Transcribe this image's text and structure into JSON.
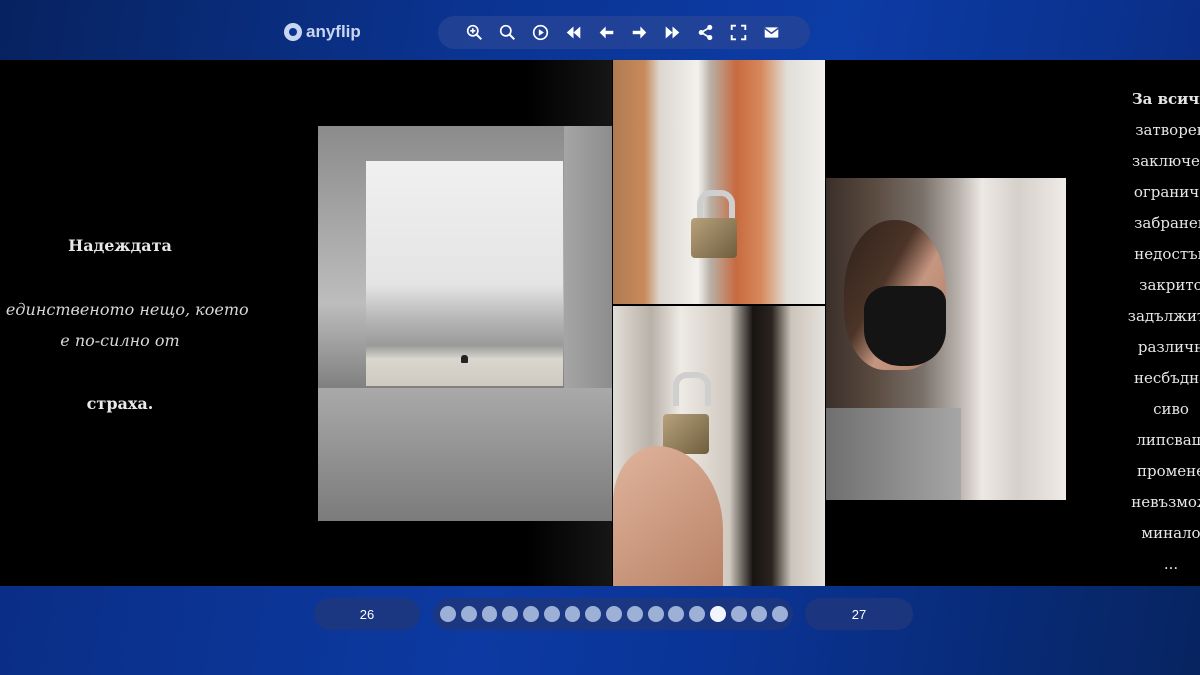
{
  "app": {
    "logo_text": "anyflip"
  },
  "toolbar": {
    "buttons": [
      {
        "icon": "zoom-in-icon"
      },
      {
        "icon": "search-icon"
      },
      {
        "icon": "autoplay-icon"
      },
      {
        "icon": "first-page-icon"
      },
      {
        "icon": "previous-page-icon"
      },
      {
        "icon": "next-page-icon"
      },
      {
        "icon": "last-page-icon"
      },
      {
        "icon": "share-icon"
      },
      {
        "icon": "fullscreen-icon"
      },
      {
        "icon": "email-icon"
      }
    ]
  },
  "left_page": {
    "title": "Надеждата",
    "line1": "е единственото нещо, което",
    "line2": "е по-силно от",
    "ending": "страха."
  },
  "right_page": {
    "words": [
      "За всичк",
      "затворен",
      "заключен",
      "ограниче",
      "забранен",
      "недостъп",
      "закрито",
      "задължите",
      "различн",
      "несбъдна",
      "сиво",
      "липсваш",
      "промене",
      "невъзмож",
      "минало",
      "..."
    ]
  },
  "pagination": {
    "left_page_number": "26",
    "right_page_number": "27",
    "total_dots": 17,
    "active_dot_index": 13
  },
  "colors": {
    "brand_blue": "#0b3492",
    "dot_inactive": "#9db0d6",
    "dot_active": "#f2f5fc"
  }
}
